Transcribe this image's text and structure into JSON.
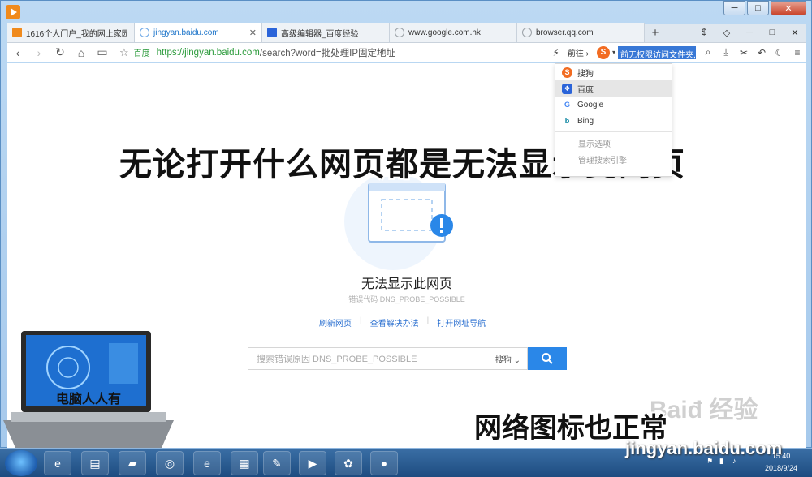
{
  "window": {
    "minimize": "─",
    "maximize": "□",
    "close": "✕"
  },
  "tabs": [
    {
      "label": "1616个人门户_我的网上家园",
      "color": "#f08a1c",
      "active": false
    },
    {
      "label": "jingyan.baidu.com",
      "color": "#6aa6e6",
      "active": true
    },
    {
      "label": "高级编辑器_百度经验",
      "color": "#2b64d9",
      "active": false
    },
    {
      "label": "www.google.com.hk",
      "color": "#9aa0a6",
      "active": false
    },
    {
      "label": "browser.qq.com",
      "color": "#9aa0a6",
      "active": false
    }
  ],
  "tab_tools": [
    "$",
    "◇",
    "─",
    "□",
    "✕"
  ],
  "address": {
    "site_tag": "百度",
    "url_scheme": "https://jingyan.baidu.com",
    "url_rest": "/search?word=批处理IP固定地址",
    "goto": "前往 ›",
    "search_value": "前无权限访问文件夹,"
  },
  "engines": [
    {
      "name": "搜狗",
      "color": "#f26c22",
      "glyph": "S",
      "hover": false
    },
    {
      "name": "百度",
      "color": "#2b64d9",
      "glyph": "❖",
      "hover": true
    },
    {
      "name": "Google",
      "color": "#4285f4",
      "glyph": "G",
      "hover": false
    },
    {
      "name": "Bing",
      "color": "#00809d",
      "glyph": "b",
      "hover": false
    }
  ],
  "engine_extras": [
    "显示选项",
    "管理搜索引擎"
  ],
  "overlay": {
    "title": "无论打开什么网页都是无法显示此网页",
    "subtitle": "网络图标也正常"
  },
  "error": {
    "title": "无法显示此网页",
    "code": "错误代码 DNS_PROBE_POSSIBLE",
    "links": [
      "刷新网页",
      "查看解决办法",
      "打开网址导航"
    ],
    "search_placeholder": "搜索错误原因 DNS_PROBE_POSSIBLE",
    "search_engine": "搜狗 ⌄"
  },
  "laptop_label": "电脑人人有",
  "watermark": "Baiđ 经验",
  "watermark_url": "jingyan.baidu.com",
  "clock": {
    "time": "15:40",
    "date": "2018/9/24"
  }
}
